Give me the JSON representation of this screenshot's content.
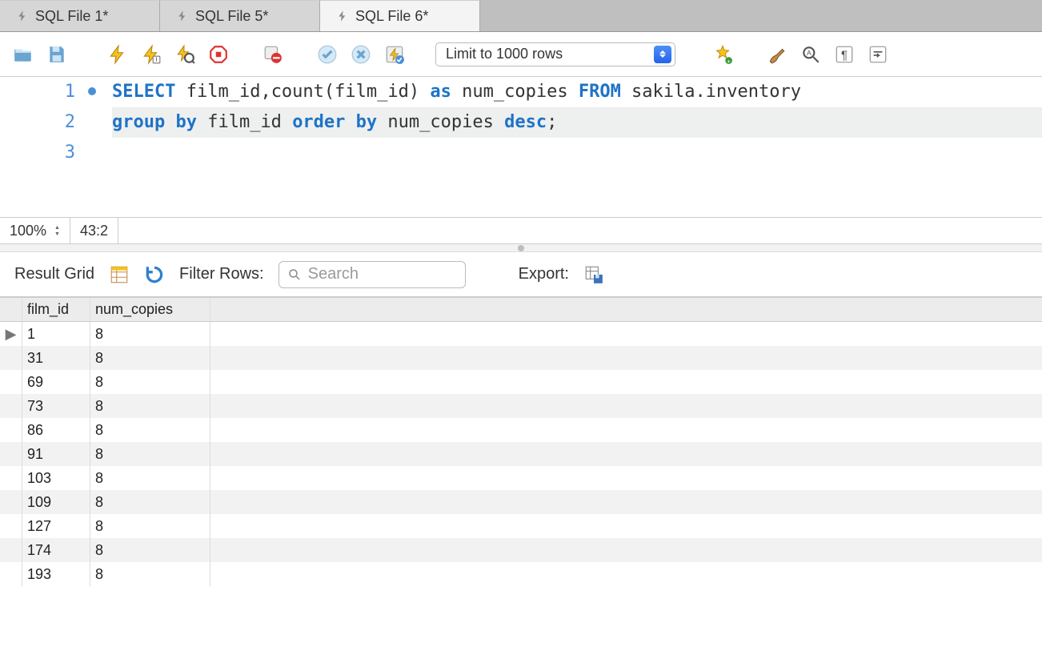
{
  "tabs": [
    {
      "label": "SQL File 1*",
      "active": false
    },
    {
      "label": "SQL File 5*",
      "active": false
    },
    {
      "label": "SQL File 6*",
      "active": true
    }
  ],
  "toolbar": {
    "limit_label": "Limit to 1000 rows"
  },
  "editor": {
    "lines": [
      {
        "n": "1",
        "mark": true,
        "tokens": [
          {
            "t": "SELECT",
            "c": "kw"
          },
          {
            "t": " film_id,count(film_id) ",
            "c": "plain"
          },
          {
            "t": "as",
            "c": "kw"
          },
          {
            "t": " num_copies ",
            "c": "plain"
          },
          {
            "t": "FROM",
            "c": "kw"
          },
          {
            "t": " sakila.inventory",
            "c": "plain"
          }
        ],
        "hl": false
      },
      {
        "n": "2",
        "mark": false,
        "tokens": [
          {
            "t": "group by",
            "c": "kw"
          },
          {
            "t": " film_id ",
            "c": "plain"
          },
          {
            "t": "order by",
            "c": "kw"
          },
          {
            "t": " num_copies ",
            "c": "plain"
          },
          {
            "t": "desc",
            "c": "kw"
          },
          {
            "t": ";",
            "c": "plain"
          }
        ],
        "hl": true
      },
      {
        "n": "3",
        "mark": false,
        "tokens": [],
        "hl": false
      }
    ]
  },
  "status": {
    "zoom": "100%",
    "pos": "43:2"
  },
  "result_toolbar": {
    "title": "Result Grid",
    "filter_label": "Filter Rows:",
    "search_placeholder": "Search",
    "export_label": "Export:"
  },
  "result": {
    "columns": [
      "film_id",
      "num_copies"
    ],
    "rows": [
      {
        "film_id": "1",
        "num_copies": "8",
        "current": true
      },
      {
        "film_id": "31",
        "num_copies": "8"
      },
      {
        "film_id": "69",
        "num_copies": "8"
      },
      {
        "film_id": "73",
        "num_copies": "8"
      },
      {
        "film_id": "86",
        "num_copies": "8"
      },
      {
        "film_id": "91",
        "num_copies": "8"
      },
      {
        "film_id": "103",
        "num_copies": "8"
      },
      {
        "film_id": "109",
        "num_copies": "8"
      },
      {
        "film_id": "127",
        "num_copies": "8"
      },
      {
        "film_id": "174",
        "num_copies": "8"
      },
      {
        "film_id": "193",
        "num_copies": "8"
      }
    ]
  }
}
